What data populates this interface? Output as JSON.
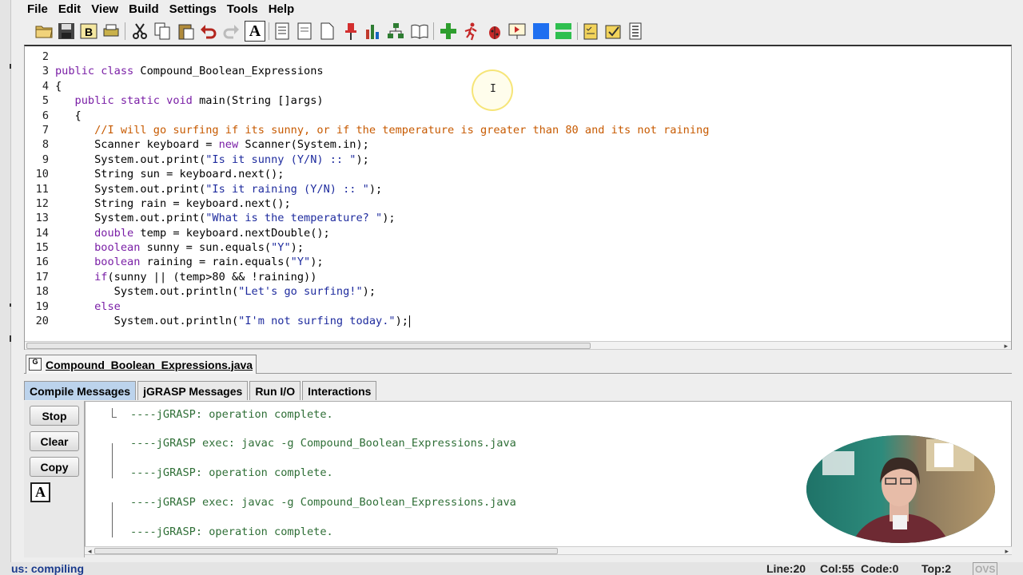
{
  "menu": [
    "File",
    "Edit",
    "View",
    "Build",
    "Settings",
    "Tools",
    "Help"
  ],
  "toolbar": {
    "icons": [
      "open-folder-icon",
      "save-icon",
      "backup-icon",
      "print-icon",
      "cut-icon",
      "copy-icon",
      "paste-icon",
      "undo-icon",
      "redo-icon",
      "font-icon",
      "generate-csd-icon",
      "remove-csd-icon",
      "new-file-icon",
      "pin-icon",
      "bar-chart-icon",
      "uml-icon",
      "book-icon",
      "compile-icon",
      "run-icon",
      "debug-icon",
      "animation-icon",
      "blue-square-icon",
      "green-split-icon",
      "notes-icon",
      "check-icon",
      "document-icon"
    ],
    "font_letter": "A"
  },
  "editor": {
    "lines": [
      {
        "n": "2",
        "parts": []
      },
      {
        "n": "3",
        "parts": [
          [
            "kw",
            "public class "
          ],
          [
            "tx",
            "Compound_Boolean_Expressions"
          ]
        ]
      },
      {
        "n": "4",
        "parts": [
          [
            "tx",
            "{"
          ]
        ]
      },
      {
        "n": "5",
        "parts": [
          [
            "kw",
            "   public static void "
          ],
          [
            "tx",
            "main(String []args)"
          ]
        ]
      },
      {
        "n": "6",
        "parts": [
          [
            "tx",
            "   {"
          ]
        ]
      },
      {
        "n": "7",
        "parts": [
          [
            "cm",
            "      //I will go surfing if its sunny, or if the temperature is greater than 80 and its not raining"
          ]
        ]
      },
      {
        "n": "8",
        "parts": [
          [
            "tx",
            "      Scanner keyboard = "
          ],
          [
            "kw",
            "new "
          ],
          [
            "tx",
            "Scanner(System.in);"
          ]
        ]
      },
      {
        "n": "9",
        "parts": [
          [
            "tx",
            "      System.out.print("
          ],
          [
            "str",
            "\"Is it sunny (Y/N) :: \""
          ],
          [
            "tx",
            ");"
          ]
        ]
      },
      {
        "n": "10",
        "parts": [
          [
            "tx",
            "      String sun = keyboard.next();"
          ]
        ]
      },
      {
        "n": "11",
        "parts": [
          [
            "tx",
            "      System.out.print("
          ],
          [
            "str",
            "\"Is it raining (Y/N) :: \""
          ],
          [
            "tx",
            ");"
          ]
        ]
      },
      {
        "n": "12",
        "parts": [
          [
            "tx",
            "      String rain = keyboard.next();"
          ]
        ]
      },
      {
        "n": "13",
        "parts": [
          [
            "tx",
            "      System.out.print("
          ],
          [
            "str",
            "\"What is the temperature? \""
          ],
          [
            "tx",
            ");"
          ]
        ]
      },
      {
        "n": "14",
        "parts": [
          [
            "kw",
            "      double "
          ],
          [
            "tx",
            "temp = keyboard.nextDouble();"
          ]
        ]
      },
      {
        "n": "15",
        "parts": [
          [
            "kw",
            "      boolean "
          ],
          [
            "tx",
            "sunny = sun.equals("
          ],
          [
            "str",
            "\"Y\""
          ],
          [
            "tx",
            ");"
          ]
        ]
      },
      {
        "n": "16",
        "parts": [
          [
            "kw",
            "      boolean "
          ],
          [
            "tx",
            "raining = rain.equals("
          ],
          [
            "str",
            "\"Y\""
          ],
          [
            "tx",
            ");"
          ]
        ]
      },
      {
        "n": "17",
        "parts": [
          [
            "kw",
            "      if"
          ],
          [
            "tx",
            "(sunny || (temp>80 && !raining))"
          ]
        ]
      },
      {
        "n": "18",
        "parts": [
          [
            "tx",
            "         System.out.println("
          ],
          [
            "str",
            "\"Let's go surfing!\""
          ],
          [
            "tx",
            ");"
          ]
        ]
      },
      {
        "n": "19",
        "parts": [
          [
            "kw",
            "      else"
          ]
        ]
      },
      {
        "n": "20",
        "parts": [
          [
            "tx",
            "         System.out.println("
          ],
          [
            "str",
            "\"I'm not surfing today.\""
          ],
          [
            "tx",
            ");"
          ]
        ]
      }
    ],
    "cursor_glyph": "I"
  },
  "file_tab": {
    "label": "Compound_Boolean_Expressions.java",
    "icon_text": "G"
  },
  "bottom_tabs": [
    "Compile Messages",
    "jGRASP Messages",
    "Run I/O",
    "Interactions"
  ],
  "side_buttons": {
    "stop": "Stop",
    "clear": "Clear",
    "copy": "Copy",
    "font_letter": "A"
  },
  "messages": [
    "----jGRASP: operation complete.",
    "----jGRASP exec: javac -g Compound_Boolean_Expressions.java",
    "----jGRASP: operation complete.",
    "----jGRASP exec: javac -g Compound_Boolean_Expressions.java",
    "----jGRASP: operation complete."
  ],
  "status": {
    "left": "us: compiling",
    "line": "Line:20",
    "col": "Col:55",
    "code": "Code:0",
    "top": "Top:2",
    "mode": "OVS"
  },
  "colors": {
    "keyword": "#7a1fa6",
    "string": "#1e2b9e",
    "comment": "#c75a00",
    "message": "#2e6e36",
    "active_tab": "#bcd3ec"
  }
}
